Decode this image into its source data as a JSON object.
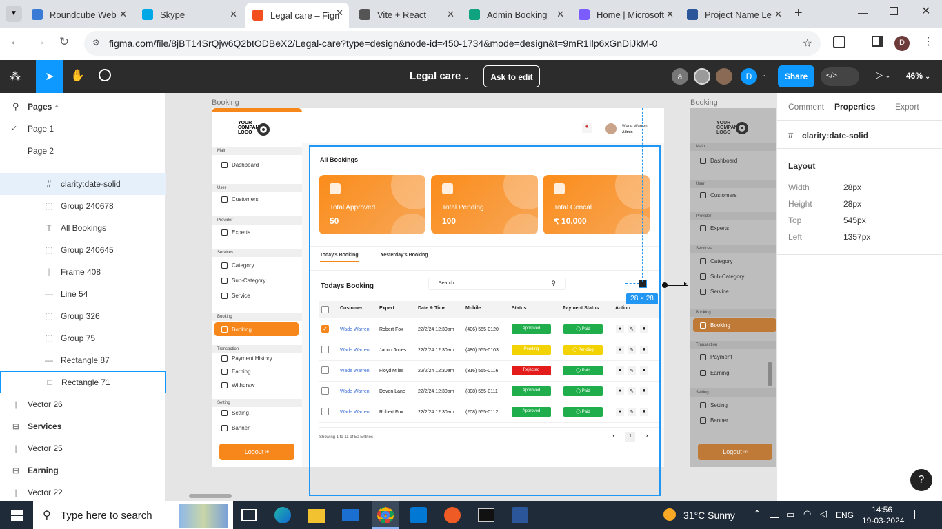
{
  "browser": {
    "tabs": [
      {
        "label": "Roundcube Web",
        "color": "#3a7bd5"
      },
      {
        "label": "Skype",
        "color": "#00a8e8"
      },
      {
        "label": "Legal care – Figma",
        "color": "#f24e1e"
      },
      {
        "label": "Vite + React",
        "color": "#555555"
      },
      {
        "label": "Admin Booking",
        "color": "#10a37f"
      },
      {
        "label": "Home | Microsoft",
        "color": "#7b5cff"
      },
      {
        "label": "Project Name Le",
        "color": "#2b579a"
      }
    ],
    "url": "figma.com/file/8jBT14SrQjw6Q2btODBeX2/Legal-care?type=design&node-id=450-1734&mode=design&t=9mR1Ilp6xGnDiJkM-0",
    "profile_initial": "D"
  },
  "figma": {
    "file_name": "Legal care",
    "ask_to_edit": "Ask to edit",
    "share": "Share",
    "zoom": "46%",
    "avatar_a": "a",
    "avatar_d": "D"
  },
  "left_panel": {
    "pages_title": "Pages",
    "pages": [
      "Page 1",
      "Page 2"
    ],
    "layers": [
      {
        "label": "clarity:date-solid",
        "icon": "#"
      },
      {
        "label": "Group 240678",
        "icon": "⬚"
      },
      {
        "label": "All Bookings",
        "icon": "T"
      },
      {
        "label": "Group 240645",
        "icon": "⬚"
      },
      {
        "label": "Frame 408",
        "icon": "⫼"
      },
      {
        "label": "Line 54",
        "icon": "—"
      },
      {
        "label": "Group 326",
        "icon": "⬚"
      },
      {
        "label": "Group 75",
        "icon": "⬚"
      },
      {
        "label": "Rectangle 87",
        "icon": "—"
      },
      {
        "label": "Rectangle 71",
        "icon": "□"
      }
    ],
    "top_layers": [
      {
        "label": "Vector 26",
        "icon": "|"
      },
      {
        "label": "Services",
        "icon": "⊟"
      },
      {
        "label": "Vector 25",
        "icon": "|"
      },
      {
        "label": "Earning",
        "icon": "⊟"
      },
      {
        "label": "Vector 22",
        "icon": "|"
      }
    ]
  },
  "design": {
    "frame_label": "Booking",
    "frame_label_right": "Booking",
    "logo": "YOUR COMPANY LOGO",
    "user_name": "Wade Warren",
    "user_role": "Admin",
    "sidebar": [
      {
        "section": "Main",
        "items": [
          "Dashboard"
        ]
      },
      {
        "section": "User",
        "items": [
          "Customers"
        ]
      },
      {
        "section": "Provider",
        "items": [
          "Experts"
        ]
      },
      {
        "section": "Services",
        "items": [
          "Category",
          "Sub-Category",
          "Service"
        ]
      },
      {
        "section": "Booking",
        "items": [
          "Booking"
        ]
      },
      {
        "section": "Transaction",
        "items": [
          "Payment History",
          "Earning",
          "Withdraw"
        ]
      },
      {
        "section": "Setting",
        "items": [
          "Setting",
          "Banner"
        ]
      }
    ],
    "logout": "Logout",
    "page_title": "All Bookings",
    "cards": [
      {
        "label": "Total Approved",
        "value": "50"
      },
      {
        "label": "Total Pending",
        "value": "100"
      },
      {
        "label": "Total Cencal",
        "value": "₹ 10,000"
      }
    ],
    "tabs": [
      "Today's Booking",
      "Yesterday's Booking"
    ],
    "table_title": "Todays Booking",
    "search_placeholder": "Search",
    "size_badge": "28 × 28",
    "columns": [
      "Customer",
      "Expert",
      "Date & Time",
      "Mobile",
      "Status",
      "Payment Status",
      "Action"
    ],
    "rows": [
      {
        "customer": "Wade Warren",
        "expert": "Robert Fox",
        "date": "22/2/24 12:30am",
        "mobile": "(406) 555-0120",
        "status": "Approved",
        "status_color": "#1fae4b",
        "payment": "Paid",
        "payment_color": "#1fae4b",
        "checked": true
      },
      {
        "customer": "Wade Warren",
        "expert": "Jacob Jones",
        "date": "22/2/24 12:30am",
        "mobile": "(480) 555-0103",
        "status": "Pending",
        "status_color": "#f2d200",
        "payment": "Pending",
        "payment_color": "#f2d200",
        "checked": false
      },
      {
        "customer": "Wade Warren",
        "expert": "Floyd Miles",
        "date": "22/2/24 12:30am",
        "mobile": "(316) 555-0116",
        "status": "Rejected",
        "status_color": "#e31b1b",
        "payment": "Paid",
        "payment_color": "#1fae4b",
        "checked": false
      },
      {
        "customer": "Wade Warren",
        "expert": "Devon Lane",
        "date": "22/2/24 12:30am",
        "mobile": "(808) 555-0111",
        "status": "Approved",
        "status_color": "#1fae4b",
        "payment": "Paid",
        "payment_color": "#1fae4b",
        "checked": false
      },
      {
        "customer": "Wade Warren",
        "expert": "Robert Fox",
        "date": "22/2/24 12:30am",
        "mobile": "(208) 555-0112",
        "status": "Approved",
        "status_color": "#1fae4b",
        "payment": "Paid",
        "payment_color": "#1fae4b",
        "checked": false
      }
    ],
    "footer_text": "Showing 1 to 11 of 50 Entries",
    "page_number": "1",
    "right_sidebar": [
      {
        "section": "Main",
        "items": [
          "Dashboard"
        ]
      },
      {
        "section": "User",
        "items": [
          "Customers"
        ]
      },
      {
        "section": "Provider",
        "items": [
          "Experts"
        ]
      },
      {
        "section": "Services",
        "items": [
          "Category",
          "Sub-Category",
          "Service"
        ]
      },
      {
        "section": "Booking",
        "items": [
          "Booking"
        ]
      },
      {
        "section": "Transaction",
        "items": [
          "Payment",
          "Earning"
        ]
      },
      {
        "section": "Setting",
        "items": [
          "Setting",
          "Banner"
        ]
      }
    ]
  },
  "right_panel": {
    "tabs": [
      "Comment",
      "Properties",
      "Export"
    ],
    "selected_layer": "clarity:date-solid",
    "layout_title": "Layout",
    "props": [
      {
        "label": "Width",
        "value": "28px"
      },
      {
        "label": "Height",
        "value": "28px"
      },
      {
        "label": "Top",
        "value": "545px"
      },
      {
        "label": "Left",
        "value": "1357px"
      }
    ],
    "help": "?"
  },
  "taskbar": {
    "search": "Type here to search",
    "weather": "31°C  Sunny",
    "lang": "ENG",
    "time": "14:56",
    "date": "19-03-2024"
  },
  "colors": {
    "accent": "#f7871a",
    "figma_blue": "#0d99ff",
    "selection": "#2196f3"
  }
}
